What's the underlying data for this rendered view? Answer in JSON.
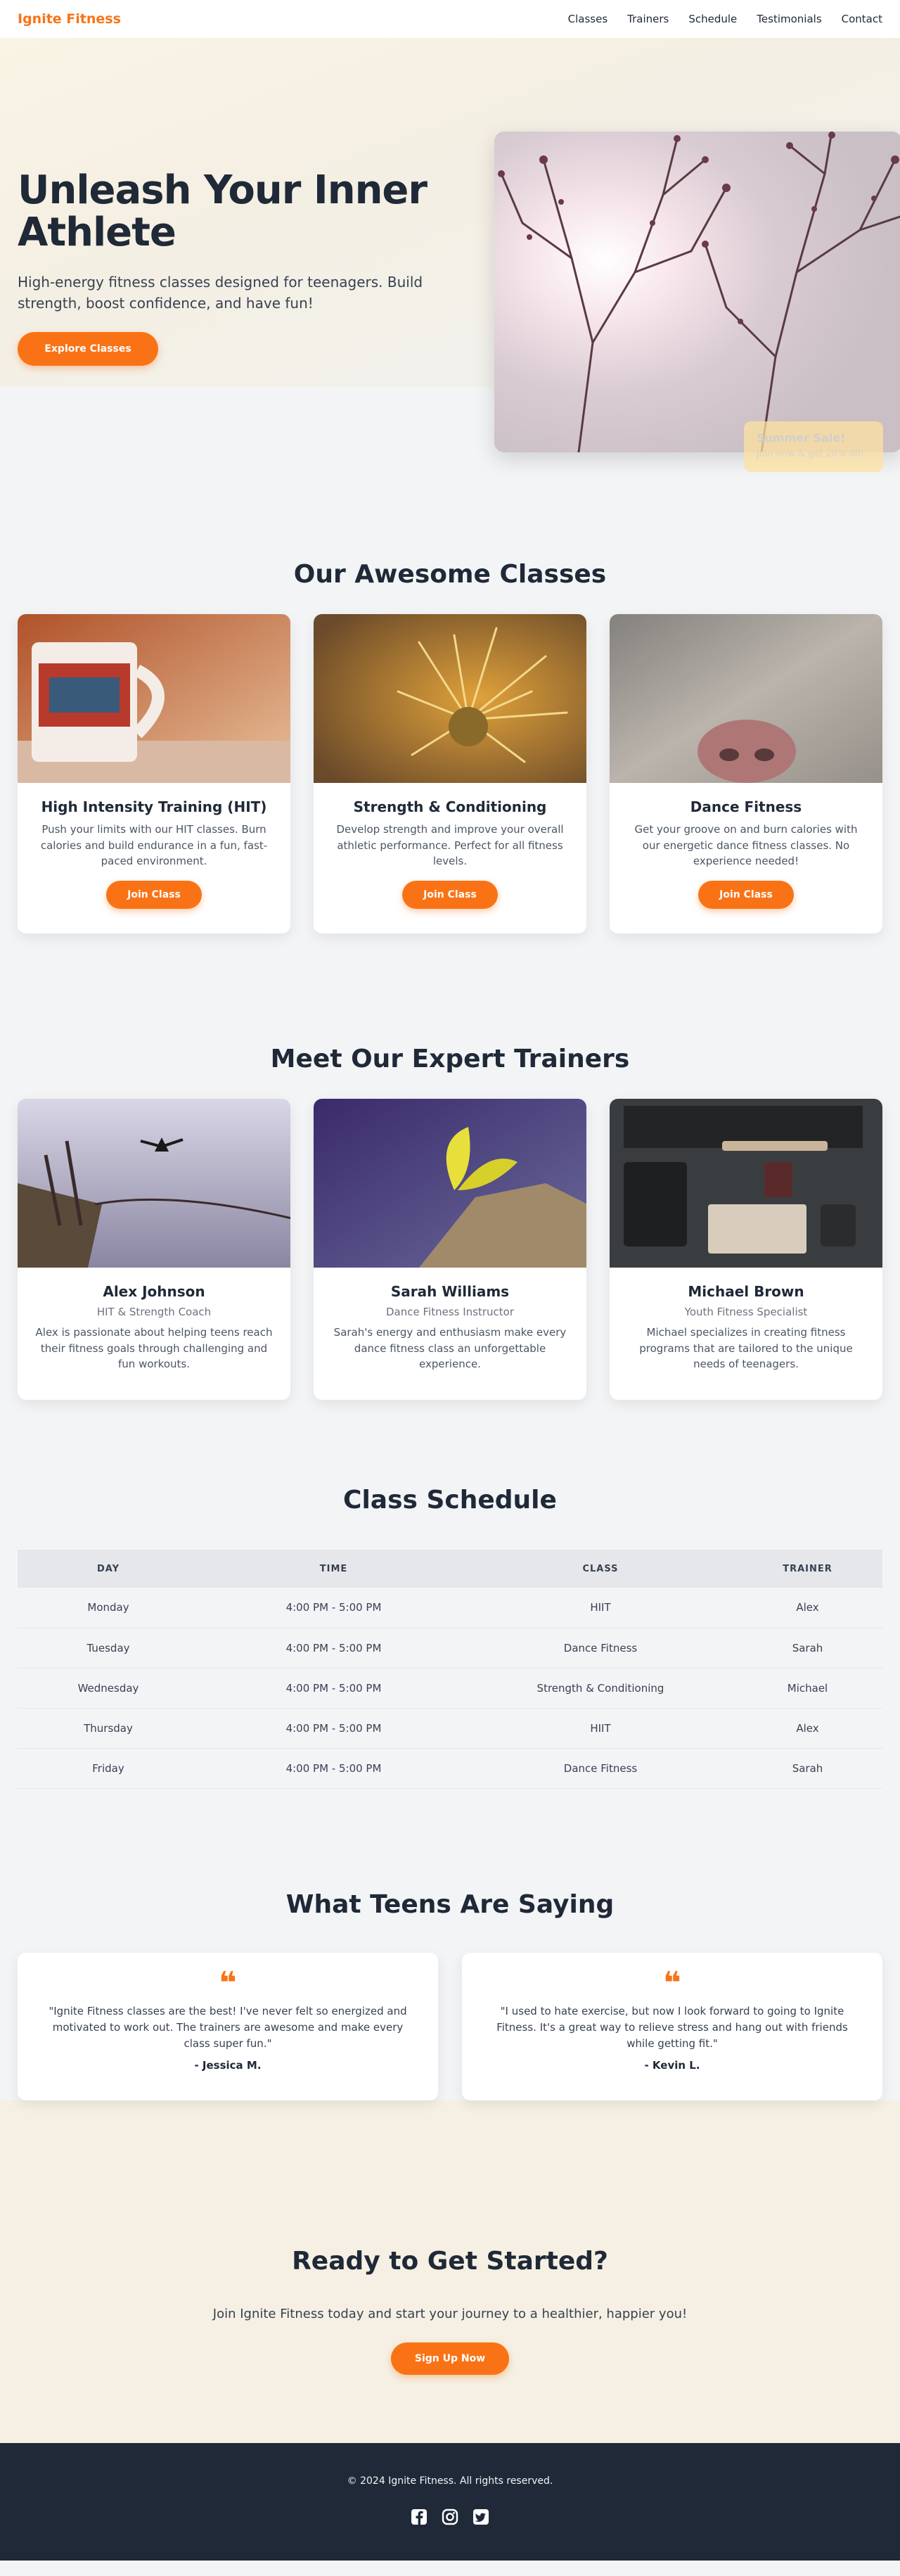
{
  "nav": {
    "brand": "Ignite Fitness",
    "links": [
      "Classes",
      "Trainers",
      "Schedule",
      "Testimonials",
      "Contact"
    ]
  },
  "hero": {
    "title": "Unleash Your Inner Athlete",
    "subtitle": "High-energy fitness classes designed for teenagers. Build strength, boost confidence, and have fun!",
    "button": "Explore Classes",
    "badge_title": "Summer Sale!",
    "badge_sub": "Join now & get 20% off!"
  },
  "classes": {
    "title": "Our Awesome Classes",
    "items": [
      {
        "name": "High Intensity Training (HIT)",
        "desc": "Push your limits with our HIT classes. Burn calories and build endurance in a fun, fast-paced environment.",
        "button": "Join Class"
      },
      {
        "name": "Strength & Conditioning",
        "desc": "Develop strength and improve your overall athletic performance. Perfect for all fitness levels.",
        "button": "Join Class"
      },
      {
        "name": "Dance Fitness",
        "desc": "Get your groove on and burn calories with our energetic dance fitness classes. No experience needed!",
        "button": "Join Class"
      }
    ]
  },
  "trainers": {
    "title": "Meet Our Expert Trainers",
    "items": [
      {
        "name": "Alex Johnson",
        "role": "HIT & Strength Coach",
        "bio": "Alex is passionate about helping teens reach their fitness goals through challenging and fun workouts."
      },
      {
        "name": "Sarah Williams",
        "role": "Dance Fitness Instructor",
        "bio": "Sarah's energy and enthusiasm make every dance fitness class an unforgettable experience."
      },
      {
        "name": "Michael Brown",
        "role": "Youth Fitness Specialist",
        "bio": "Michael specializes in creating fitness programs that are tailored to the unique needs of teenagers."
      }
    ]
  },
  "schedule": {
    "title": "Class Schedule",
    "headers": [
      "DAY",
      "TIME",
      "CLASS",
      "TRAINER"
    ],
    "rows": [
      [
        "Monday",
        "4:00 PM - 5:00 PM",
        "HIIT",
        "Alex"
      ],
      [
        "Tuesday",
        "4:00 PM - 5:00 PM",
        "Dance Fitness",
        "Sarah"
      ],
      [
        "Wednesday",
        "4:00 PM - 5:00 PM",
        "Strength & Conditioning",
        "Michael"
      ],
      [
        "Thursday",
        "4:00 PM - 5:00 PM",
        "HIIT",
        "Alex"
      ],
      [
        "Friday",
        "4:00 PM - 5:00 PM",
        "Dance Fitness",
        "Sarah"
      ]
    ]
  },
  "testimonials": {
    "title": "What Teens Are Saying",
    "quote_glyph": "❝",
    "items": [
      {
        "text": "\"Ignite Fitness classes are the best! I've never felt so energized and motivated to work out. The trainers are awesome and make every class super fun.\"",
        "author": "- Jessica M."
      },
      {
        "text": "\"I used to hate exercise, but now I look forward to going to Ignite Fitness. It's a great way to relieve stress and hang out with friends while getting fit.\"",
        "author": "- Kevin L."
      }
    ]
  },
  "cta": {
    "title": "Ready to Get Started?",
    "text": "Join Ignite Fitness today and start your journey to a healthier, happier you!",
    "button": "Sign Up Now"
  },
  "footer": {
    "copyright": "© 2024 Ignite Fitness. All rights reserved.",
    "social": [
      "facebook-icon",
      "instagram-icon",
      "twitter-icon"
    ]
  },
  "colors": {
    "accent": "#f97316",
    "dark": "#1f2937",
    "background": "#f3f4f6"
  }
}
